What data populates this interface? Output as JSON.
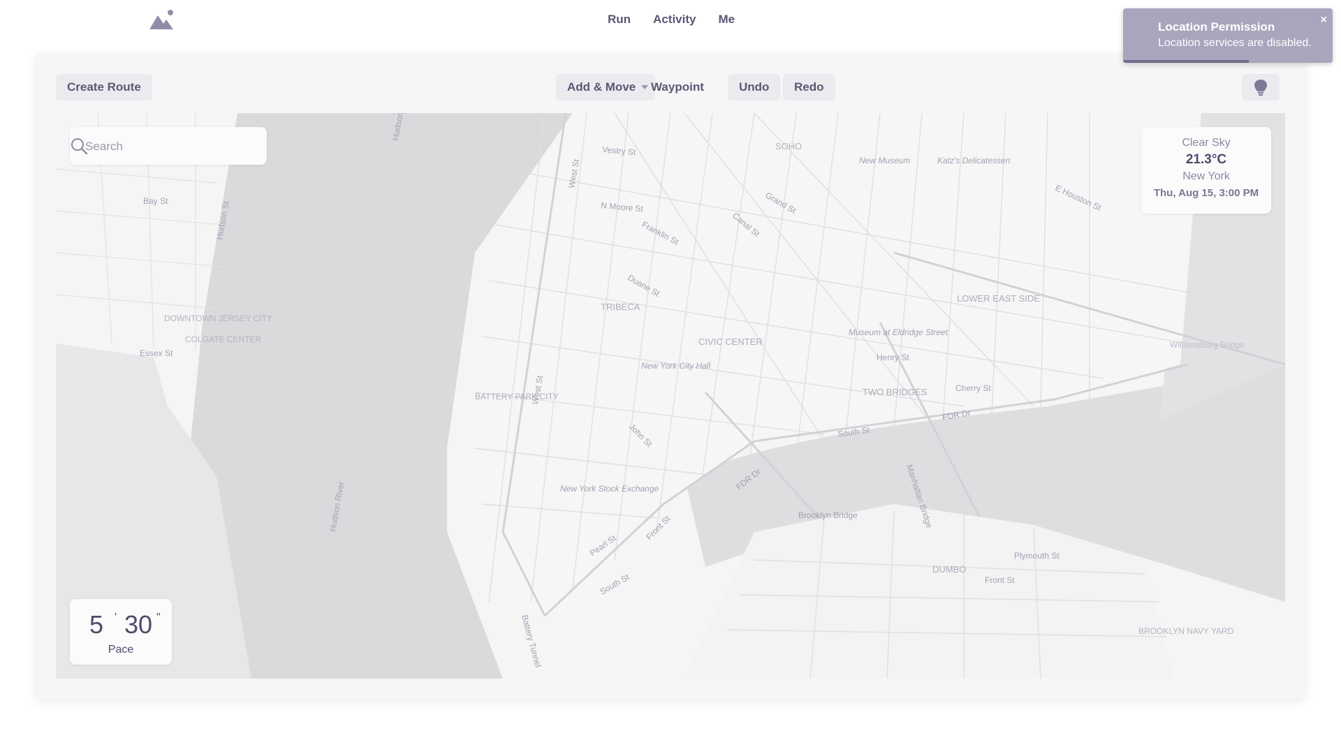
{
  "nav": {
    "items": [
      "Run",
      "Activity",
      "Me"
    ]
  },
  "toolbar": {
    "create_route": "Create Route",
    "add_move": "Add & Move",
    "waypoint": "Waypoint",
    "undo": "Undo",
    "redo": "Redo"
  },
  "search": {
    "placeholder": "Search"
  },
  "weather": {
    "condition": "Clear Sky",
    "temperature": "21.3°C",
    "city": "New York",
    "datetime": "Thu, Aug 15, 3:00 PM"
  },
  "pace": {
    "minutes": "5",
    "minutes_mark": "'",
    "seconds": "30",
    "seconds_mark": "\"",
    "label": "Pace"
  },
  "toast": {
    "title": "Location Permission",
    "message": "Location services are disabled.",
    "close": "×",
    "progress": 0.6
  },
  "map_labels": {
    "hudson_river": "Hudson River",
    "tribeca": "TRIBECA",
    "soho": "SOHO",
    "civic_center": "CIVIC CENTER",
    "two_bridges": "TWO BRIDGES",
    "lower_east_side": "LOWER EAST SIDE",
    "battery_park_city": "BATTERY PARK CITY",
    "downtown_jersey_city": "DOWNTOWN JERSEY CITY",
    "colgate_center": "COLGATE CENTER",
    "dumbo": "DUMBO",
    "brooklyn_navy_yard": "BROOKLYN NAVY YARD",
    "brooklyn_bridge": "Brooklyn Bridge",
    "manhattan_bridge": "Manhattan Bridge",
    "williamsburg_bridge": "Williamsburg Bridge",
    "city_hall": "New York City Hall",
    "stock_exchange": "New York Stock Exchange",
    "new_museum": "New Museum",
    "katz": "Katz's Delicatessen",
    "museum_eldridge": "Museum at Eldridge Street",
    "canal_st": "Canal St",
    "grand_st": "Grand St",
    "fdr_dr": "FDR Dr",
    "south_st": "South St",
    "west_st": "West St",
    "john_st": "John St",
    "front_st": "Front St",
    "pearl_st": "Pearl St",
    "henry_st": "Henry St",
    "cherry_st": "Cherry St",
    "e_houston_st": "E Houston St",
    "franklin_st": "Franklin St",
    "duane_st": "Duane St",
    "n_moore_st": "N Moore St",
    "vestry_st": "Vestry St",
    "plymouth_st": "Plymouth St",
    "battery_tunnel": "Battery Tunnel",
    "essex_st": "Essex St",
    "bay_st": "Bay St",
    "hudson_st": "Hudson St"
  }
}
